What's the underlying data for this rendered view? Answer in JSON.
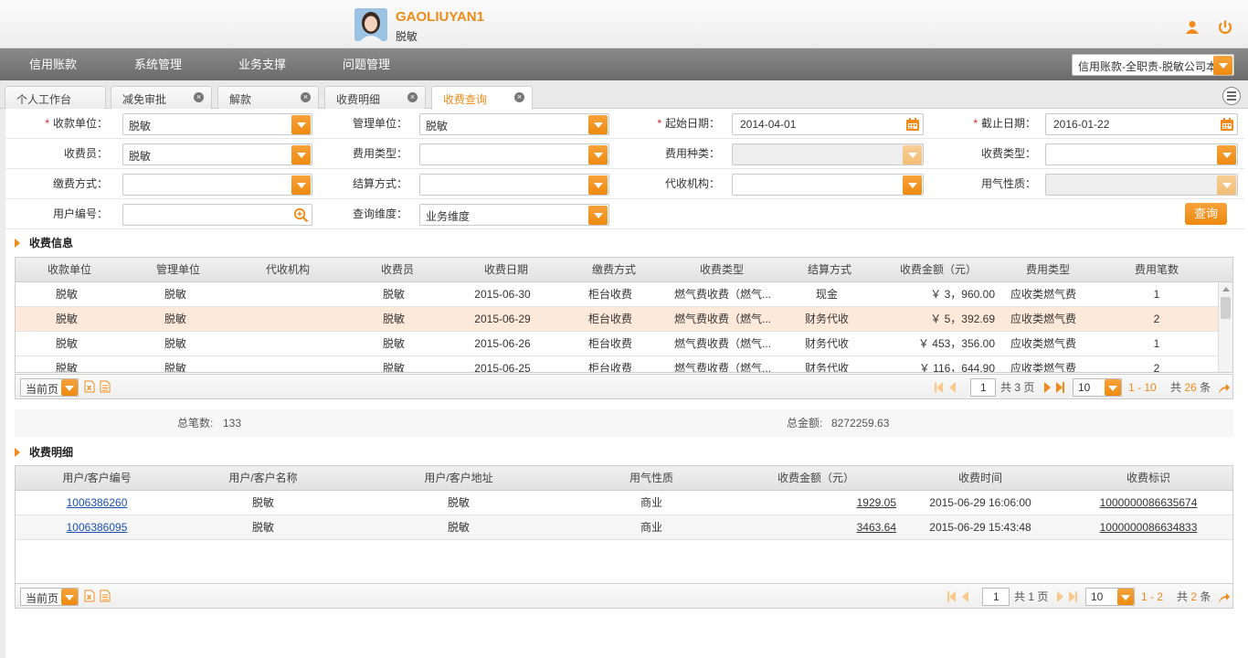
{
  "header": {
    "user_name": "GAOLIUYAN1",
    "user_org": "脱敏",
    "icons": {
      "user": "user-icon",
      "power": "power-icon"
    }
  },
  "nav": {
    "items": [
      "信用账款",
      "系统管理",
      "业务支撑",
      "问题管理"
    ],
    "role_select": "信用账款-全职责-脱敏公司本"
  },
  "tabs": [
    {
      "label": "个人工作台",
      "closable": false
    },
    {
      "label": "减免审批",
      "closable": true
    },
    {
      "label": "解款",
      "closable": true
    },
    {
      "label": "收费明细",
      "closable": true
    },
    {
      "label": "收费查询",
      "closable": true,
      "active": true
    }
  ],
  "form": {
    "row1": [
      {
        "label": "收款单位：",
        "required": true,
        "value": "脱敏"
      },
      {
        "label": "管理单位：",
        "required": false,
        "value": "脱敏"
      },
      {
        "label": "起始日期：",
        "required": true,
        "value": "2014-04-01"
      },
      {
        "label": "截止日期：",
        "required": true,
        "value": "2016-01-22"
      }
    ],
    "row2": [
      {
        "label": "收费员：",
        "value": "脱敏"
      },
      {
        "label": "费用类型：",
        "value": ""
      },
      {
        "label": "费用种类：",
        "value": ""
      },
      {
        "label": "收费类型：",
        "value": ""
      }
    ],
    "row3": [
      {
        "label": "缴费方式：",
        "value": ""
      },
      {
        "label": "结算方式：",
        "value": ""
      },
      {
        "label": "代收机构：",
        "value": ""
      },
      {
        "label": "用气性质：",
        "value": ""
      }
    ],
    "row4": [
      {
        "label": "用户编号：",
        "value": ""
      },
      {
        "label": "查询维度：",
        "value": "业务维度"
      }
    ],
    "query_label": "查询"
  },
  "fee_info": {
    "title": "收费信息",
    "columns": [
      "收款单位",
      "管理单位",
      "代收机构",
      "收费员",
      "收费日期",
      "缴费方式",
      "收费类型",
      "结算方式",
      "收费金额（元）",
      "费用类型",
      "费用笔数"
    ],
    "rows": [
      [
        "脱敏",
        "脱敏",
        "",
        "脱敏",
        "2015-06-30",
        "柜台收费",
        "燃气费收费（燃气...",
        "现金",
        "￥ 3，960.00",
        "应收类燃气费",
        "1"
      ],
      [
        "脱敏",
        "脱敏",
        "",
        "脱敏",
        "2015-06-29",
        "柜台收费",
        "燃气费收费（燃气...",
        "财务代收",
        "￥ 5，392.69",
        "应收类燃气费",
        "2"
      ],
      [
        "脱敏",
        "脱敏",
        "",
        "脱敏",
        "2015-06-26",
        "柜台收费",
        "燃气费收费（燃气...",
        "财务代收",
        "￥ 453，356.00",
        "应收类燃气费",
        "1"
      ],
      [
        "脱敏",
        "脱敏",
        "",
        "脱敏",
        "2015-06-25",
        "柜台收费",
        "燃气费收费（燃气...",
        "财务代收",
        "￥ 116，644.90",
        "应收类燃气费",
        "2"
      ]
    ],
    "pager": {
      "current_page_label": "当前页",
      "page": "1",
      "total_pages": "共 3 页",
      "page_size": "10",
      "range": "1 - 10",
      "total_prefix": "共",
      "total_count": "26",
      "total_suffix": "条"
    }
  },
  "summary": {
    "count_label": "总笔数:",
    "count": "133",
    "amount_label": "总金额:",
    "amount": "8272259.63"
  },
  "fee_detail": {
    "title": "收费明细",
    "columns": [
      "用户/客户编号",
      "用户/客户名称",
      "用户/客户地址",
      "用气性质",
      "收费金额（元）",
      "收费时间",
      "收费标识"
    ],
    "rows": [
      [
        "1006386260",
        "脱敏",
        "脱敏",
        "商业",
        "1929.05",
        "2015-06-29 16:06:00",
        "1000000086635674"
      ],
      [
        "1006386095",
        "脱敏",
        "脱敏",
        "商业",
        "3463.64",
        "2015-06-29 15:43:48",
        "1000000086634833"
      ]
    ],
    "pager": {
      "current_page_label": "当前页",
      "page": "1",
      "total_pages": "共 1 页",
      "page_size": "10",
      "range": "1 - 2",
      "total_prefix": "共",
      "total_count": "2",
      "total_suffix": "条"
    }
  },
  "colors": {
    "accent": "#f08a18",
    "nav": "#777777",
    "highlight_row": "#fde9d9",
    "link": "#1a4fb3"
  }
}
